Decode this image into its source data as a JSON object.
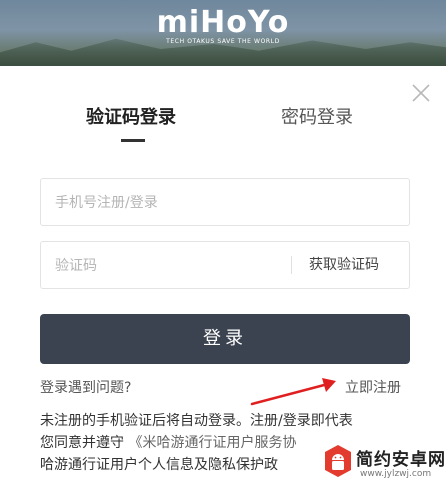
{
  "header": {
    "logo_text": "miHoYo",
    "tagline": "TECH OTAKUS SAVE THE WORLD"
  },
  "tabs": [
    {
      "label": "验证码登录",
      "active": true
    },
    {
      "label": "密码登录",
      "active": false
    }
  ],
  "form": {
    "phone_placeholder": "手机号注册/登录",
    "code_placeholder": "验证码",
    "get_code_label": "获取验证码",
    "login_label": "登录"
  },
  "links": {
    "trouble": "登录遇到问题?",
    "register": "立即注册"
  },
  "notice": {
    "line1": "未注册的手机验证后将自动登录。注册/登录即代表",
    "line2_prefix": "您同意并遵守 ",
    "line2_link": "《米哈游通行证用户服务协",
    "line3": "哈游通行证用户个人信息及隐私保护政"
  },
  "watermark": {
    "title": "简约安卓网",
    "url": "www.jylzwj.com"
  },
  "colors": {
    "button_bg": "#3b4351",
    "arrow": "#e02020",
    "text": "#333333"
  }
}
